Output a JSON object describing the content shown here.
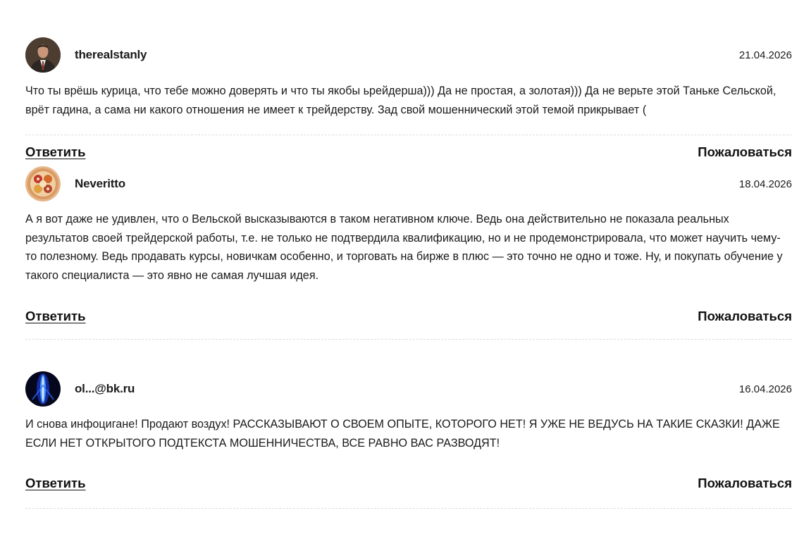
{
  "comments": [
    {
      "author": "therealstanly",
      "date": "21.04.2026",
      "avatar": "man-in-suit-avatar",
      "text": "Что ты врёшь курица, что тебе можно доверять и что ты якобы ьрейдерша))) Да не простая, а золотая))) Да не верьте этой Таньке Сельской, врёт гадина, а сама ни какого отношения не имеет к трейдерству. Зад свой мошеннический этой темой прикрывает (",
      "reply_label": "Ответить",
      "report_label": "Пожаловаться"
    },
    {
      "author": "Neveritto",
      "date": "18.04.2026",
      "avatar": "ornament-avatar",
      "text": "А я вот даже не удивлен, что о Вельской высказываются в таком негативном ключе. Ведь она действительно не показала реальных результатов своей трейдерской работы, т.е. не только не подтвердила квалификацию, но и не продемонстрировала, что может научить чему-то полезному. Ведь продавать курсы, новичкам особенно, и торговать на бирже в плюс — это точно не одно и тоже. Ну, и покупать обучение у такого специалиста — это явно не самая лучшая идея.",
      "reply_label": "Ответить",
      "report_label": "Пожаловаться"
    },
    {
      "author": "ol...@bk.ru",
      "date": "16.04.2026",
      "avatar": "blue-light-avatar",
      "text": "И снова инфоцигане! Продают воздух! РАССКАЗЫВАЮТ О СВОЕМ ОПЫТЕ, КОТОРОГО НЕТ! Я УЖЕ НЕ ВЕДУСЬ НА ТАКИЕ СКАЗКИ! ДАЖЕ ЕСЛИ НЕТ ОТКРЫТОГО ПОДТЕКСТА МОШЕННИЧЕСТВА, ВСЕ РАВНО ВАС РАЗВОДЯТ!",
      "reply_label": "Ответить",
      "report_label": "Пожаловаться"
    }
  ]
}
